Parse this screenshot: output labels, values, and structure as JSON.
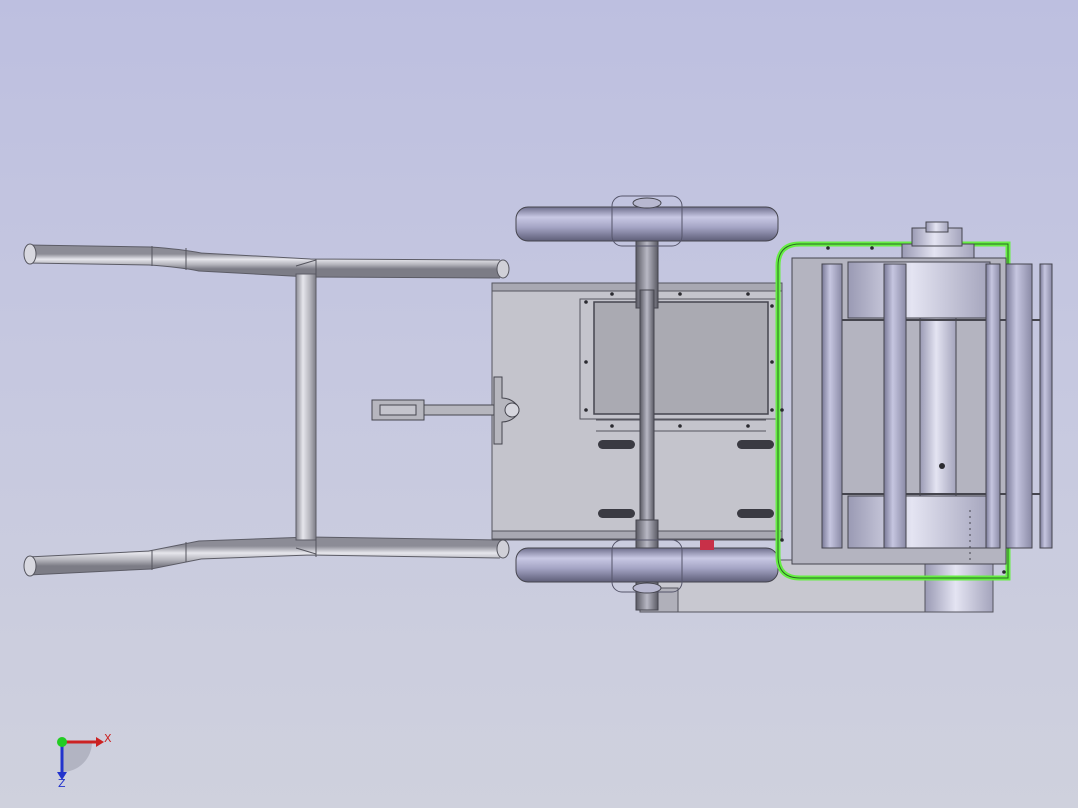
{
  "view": {
    "background_top": "#bdbfe0",
    "background_bottom": "#cfd1dd",
    "highlight_color": "#66ee44",
    "part_color": "#c4c4cc"
  },
  "triad": {
    "x_label": "X",
    "z_label": "Z",
    "x_color": "#cc2222",
    "y_color": "#22cc22",
    "z_color": "#2233cc"
  }
}
